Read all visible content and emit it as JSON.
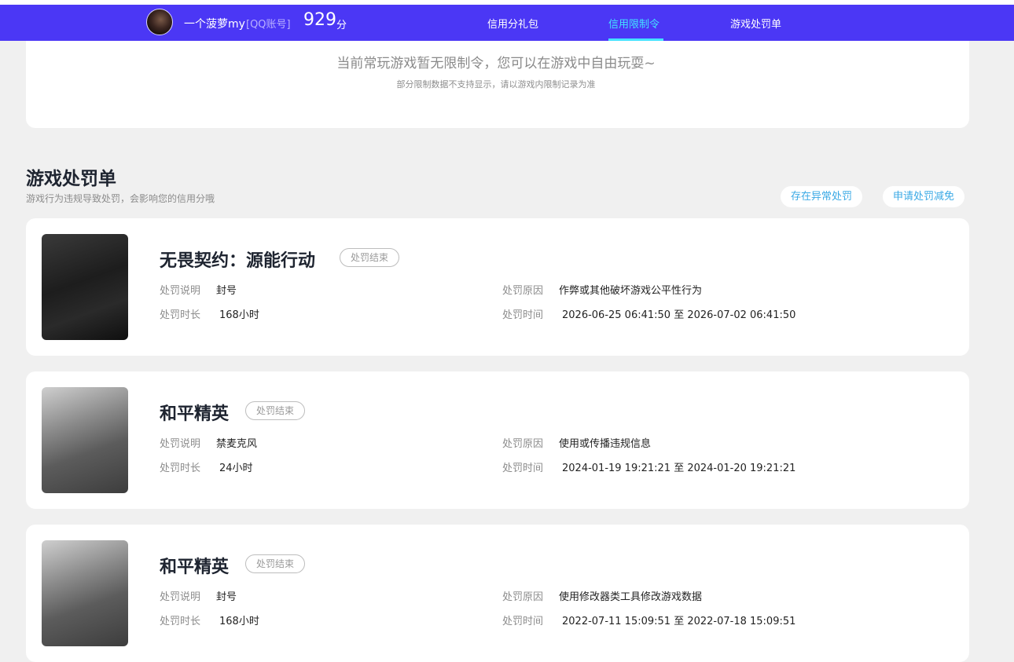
{
  "header": {
    "username": "一个菠萝my",
    "account_type": "[QQ账号]",
    "score": "929",
    "score_unit": "分",
    "tabs": [
      {
        "label": "信用分礼包"
      },
      {
        "label": "信用限制令"
      },
      {
        "label": "游戏处罚单"
      }
    ],
    "active_tab": "信用限制令",
    "accent_color": "#4b37f5",
    "active_color": "#43e3ff"
  },
  "notice": {
    "main": "当前常玩游戏暂无限制令，您可以在游戏中自由玩耍~",
    "sub": "部分限制数据不支持显示，请以游戏内限制记录为准"
  },
  "section": {
    "title": "游戏处罚单",
    "desc": "游戏行为违规导致处罚，会影响您的信用分哦",
    "buttons": [
      "存在异常处罚",
      "申请处罚减免"
    ]
  },
  "labels": {
    "desc": "处罚说明",
    "duration": "处罚时长",
    "reason": "处罚原因",
    "time": "处罚时间"
  },
  "penalties": [
    {
      "game": "无畏契约：源能行动",
      "status": "处罚结束",
      "desc": "封号",
      "duration": "168小时",
      "reason": "作弊或其他破坏游戏公平性行为",
      "time": "2026-06-25 06:41:50 至 2026-07-02 06:41:50"
    },
    {
      "game": "和平精英",
      "status": "处罚结束",
      "desc": "禁麦克风",
      "duration": "24小时",
      "reason": "使用或传播违规信息",
      "time": "2024-01-19 19:21:21 至 2024-01-20 19:21:21"
    },
    {
      "game": "和平精英",
      "status": "处罚结束",
      "desc": "封号",
      "duration": "168小时",
      "reason": "使用修改器类工具修改游戏数据",
      "time": "2022-07-11 15:09:51 至 2022-07-18 15:09:51"
    }
  ]
}
